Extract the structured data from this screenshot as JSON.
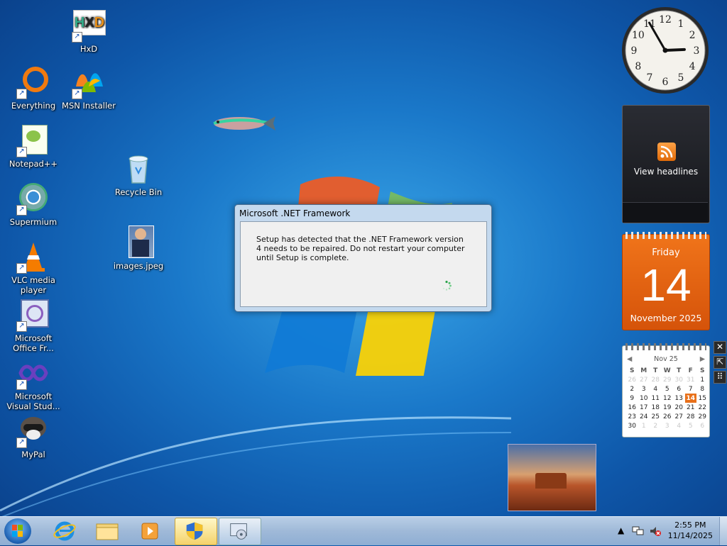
{
  "desktop": {
    "icons": [
      {
        "label": "HxD",
        "icon": "hxd-icon"
      },
      {
        "label": "Everything",
        "icon": "everything-icon"
      },
      {
        "label": "MSN Installer",
        "icon": "msn-icon"
      },
      {
        "label": "Notepad++",
        "icon": "notepadpp-icon"
      },
      {
        "label": "Recycle Bin",
        "icon": "recycle-bin-icon"
      },
      {
        "label": "Supermium",
        "icon": "supermium-icon"
      },
      {
        "label": "images.jpeg",
        "icon": "image-file-icon"
      },
      {
        "label": "VLC media player",
        "icon": "vlc-icon"
      },
      {
        "label": "Microsoft Office Fr...",
        "icon": "office-icon"
      },
      {
        "label": "Microsoft Visual Stud...",
        "icon": "visual-studio-icon"
      },
      {
        "label": "MyPal",
        "icon": "mypal-icon"
      }
    ],
    "shortcut_glyph": "↗"
  },
  "dialog": {
    "title": "Microsoft .NET Framework",
    "message": "Setup has detected that the .NET Framework version 4 needs to be repaired. Do not restart your computer until Setup is complete."
  },
  "gadgets": {
    "clock": {
      "hour": 2,
      "minute": 55,
      "numerals": [
        "12",
        "1",
        "2",
        "3",
        "4",
        "5",
        "6",
        "7",
        "8",
        "9",
        "10",
        "11"
      ]
    },
    "feed": {
      "label": "View headlines"
    },
    "calendar_big": {
      "weekday": "Friday",
      "day": "14",
      "month_year": "November 2025"
    },
    "calendar_small": {
      "header": "Nov 25",
      "weekdays": [
        "S",
        "M",
        "T",
        "W",
        "T",
        "F",
        "S"
      ],
      "today": "14",
      "weeks": [
        [
          {
            "d": "26",
            "dim": true
          },
          {
            "d": "27",
            "dim": true
          },
          {
            "d": "28",
            "dim": true
          },
          {
            "d": "29",
            "dim": true
          },
          {
            "d": "30",
            "dim": true
          },
          {
            "d": "31",
            "dim": true
          },
          {
            "d": "1",
            "dim": false
          }
        ],
        [
          {
            "d": "2",
            "dim": false
          },
          {
            "d": "3",
            "dim": false
          },
          {
            "d": "4",
            "dim": false
          },
          {
            "d": "5",
            "dim": false
          },
          {
            "d": "6",
            "dim": false
          },
          {
            "d": "7",
            "dim": false
          },
          {
            "d": "8",
            "dim": false
          }
        ],
        [
          {
            "d": "9",
            "dim": false
          },
          {
            "d": "10",
            "dim": false
          },
          {
            "d": "11",
            "dim": false
          },
          {
            "d": "12",
            "dim": false
          },
          {
            "d": "13",
            "dim": false
          },
          {
            "d": "14",
            "dim": false
          },
          {
            "d": "15",
            "dim": false
          }
        ],
        [
          {
            "d": "16",
            "dim": false
          },
          {
            "d": "17",
            "dim": false
          },
          {
            "d": "18",
            "dim": false
          },
          {
            "d": "19",
            "dim": false
          },
          {
            "d": "20",
            "dim": false
          },
          {
            "d": "21",
            "dim": false
          },
          {
            "d": "22",
            "dim": false
          }
        ],
        [
          {
            "d": "23",
            "dim": false
          },
          {
            "d": "24",
            "dim": false
          },
          {
            "d": "25",
            "dim": false
          },
          {
            "d": "26",
            "dim": false
          },
          {
            "d": "27",
            "dim": false
          },
          {
            "d": "28",
            "dim": false
          },
          {
            "d": "29",
            "dim": false
          }
        ],
        [
          {
            "d": "30",
            "dim": false
          },
          {
            "d": "1",
            "dim": true
          },
          {
            "d": "2",
            "dim": true
          },
          {
            "d": "3",
            "dim": true
          },
          {
            "d": "4",
            "dim": true
          },
          {
            "d": "5",
            "dim": true
          },
          {
            "d": "6",
            "dim": true
          }
        ]
      ]
    },
    "controls": {
      "close": "✕",
      "size": "⇱",
      "drag": "⠿"
    }
  },
  "taskbar": {
    "items": [
      {
        "icon": "internet-explorer-icon",
        "state": "pinned"
      },
      {
        "icon": "file-explorer-icon",
        "state": "pinned"
      },
      {
        "icon": "media-player-icon",
        "state": "pinned"
      },
      {
        "icon": "uac-shield-icon",
        "state": "active"
      },
      {
        "icon": "setup-window-icon",
        "state": "open"
      }
    ],
    "tray": {
      "show_hidden": "▲",
      "time": "2:55 PM",
      "date": "11/14/2025"
    }
  },
  "colors": {
    "desktop_blue": "#1a78c9",
    "calendar_orange": "#e8701a",
    "dialog_frame": "#c4d9ee"
  }
}
